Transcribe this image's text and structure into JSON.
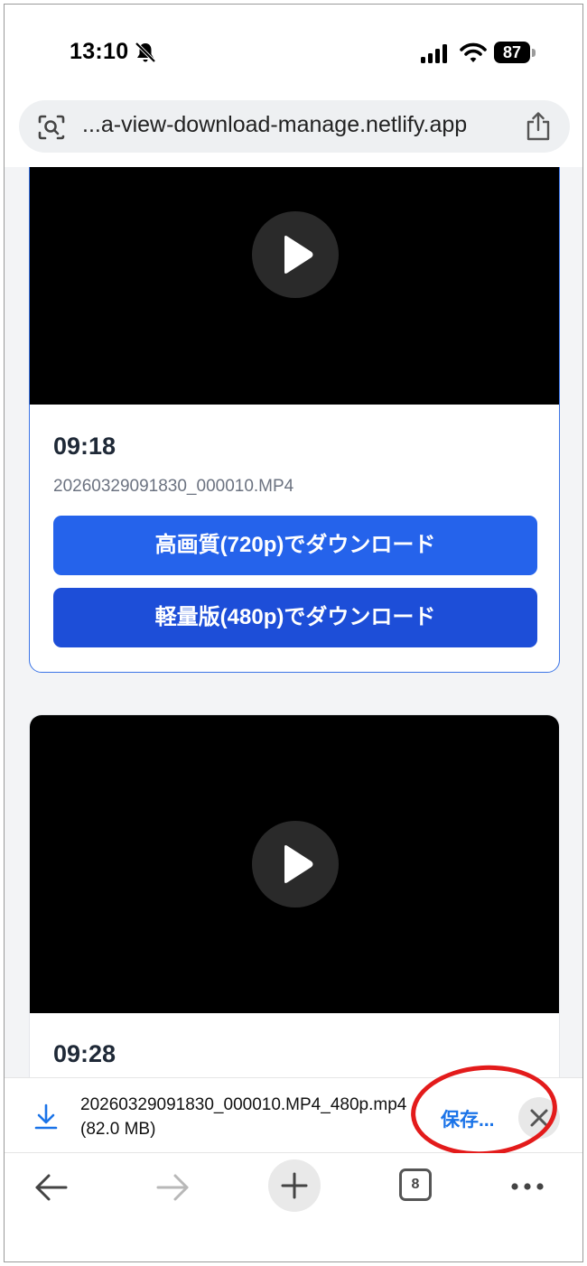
{
  "status_bar": {
    "time": "13:10",
    "battery": "87"
  },
  "address_bar": {
    "url": "...a-view-download-manage.netlify.app"
  },
  "videos": [
    {
      "time": "09:18",
      "filename": "20260329091830_000010.MP4",
      "hq_button": "高画質(720p)でダウンロード",
      "lite_button": "軽量版(480p)でダウンロード"
    },
    {
      "time": "09:28"
    }
  ],
  "download": {
    "filename": "20260329091830_000010.MP4_480p.mp4 (82.0 MB)",
    "save_label": "保存..."
  },
  "toolbar": {
    "tab_count": "8"
  },
  "colors": {
    "primary_button": "#2563eb",
    "secondary_button": "#1d4ed8",
    "link": "#1a73e8",
    "annotation": "#e31b1b"
  }
}
